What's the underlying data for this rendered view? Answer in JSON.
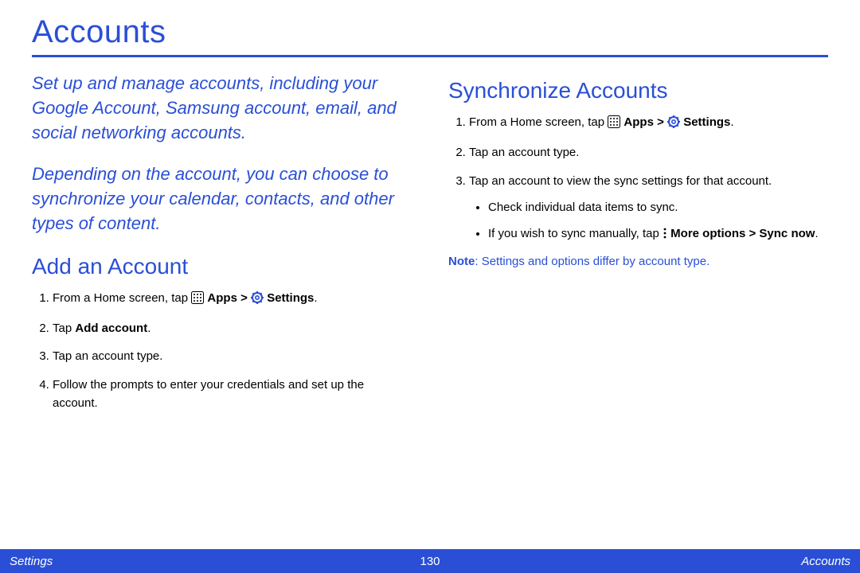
{
  "page": {
    "title": "Accounts",
    "intro1": "Set up and manage accounts, including your Google Account, Samsung account, email, and social networking accounts.",
    "intro2": "Depending on the account, you can choose to synchronize your calendar, contacts, and other types of content."
  },
  "add": {
    "heading": "Add an Account",
    "step1_a": "From a Home screen, tap ",
    "step1_apps": "Apps",
    "step1_gt": " > ",
    "step1_settings": "Settings",
    "step1_end": ".",
    "step2_a": "Tap ",
    "step2_b": "Add account",
    "step2_end": ".",
    "step3": "Tap an account type.",
    "step4": "Follow the prompts to enter your credentials and set up the account."
  },
  "sync": {
    "heading": "Synchronize Accounts",
    "step1_a": "From a Home screen, tap ",
    "step1_apps": "Apps",
    "step1_gt": " > ",
    "step1_settings": "Settings",
    "step1_end": ".",
    "step2": "Tap an account type.",
    "step3": "Tap an account to view the sync settings for that account.",
    "bullet1": "Check individual data items to sync.",
    "bullet2_a": "If you wish to sync manually, tap ",
    "bullet2_b": "More options > Sync now",
    "bullet2_end": ".",
    "note_label": "Note",
    "note_sep": ": ",
    "note_text": "Settings and options differ by account type."
  },
  "footer": {
    "left": "Settings",
    "center": "130",
    "right": "Accounts"
  }
}
